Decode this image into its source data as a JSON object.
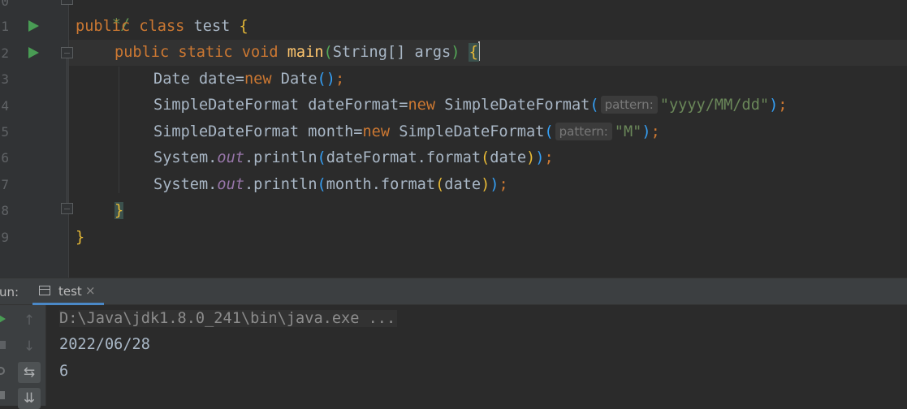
{
  "editor": {
    "line_numbers": [
      "0",
      "1",
      "2",
      "3",
      "4",
      "5",
      "6",
      "7",
      "8",
      "9"
    ],
    "comment_fragment": "*/",
    "lines": {
      "l1": {
        "kw1": "public",
        "kw2": "class",
        "name": "test",
        "brace": "{"
      },
      "l2": {
        "kw1": "public",
        "kw2": "static",
        "kw3": "void",
        "fn": "main",
        "paren_open": "(",
        "params": "String[] args",
        "paren_close": ")",
        "brace": "{"
      },
      "l3": {
        "a": "Date date=",
        "kw": "new",
        "b": "Date",
        "p_open": "(",
        "p_close": ")",
        "end": ";"
      },
      "l4": {
        "a": "SimpleDateFormat dateFormat=",
        "kw": "new",
        "b": "SimpleDateFormat",
        "p_open": "(",
        "hint": "pattern:",
        "str": "\"yyyy/MM/dd\"",
        "p_close": ")",
        "end": ";"
      },
      "l5": {
        "a": "SimpleDateFormat month=",
        "kw": "new",
        "b": "SimpleDateFormat",
        "p_open": "(",
        "hint": "pattern:",
        "str": "\"M\"",
        "p_close": ")",
        "end": ";"
      },
      "l6": {
        "a": "System.",
        "field": "out",
        "b": ".println",
        "p1_open": "(",
        "c": "dateFormat.format",
        "p2_open": "(",
        "d": "date",
        "p2_close": ")",
        "p1_close": ")",
        "end": ";"
      },
      "l7": {
        "a": "System.",
        "field": "out",
        "b": ".println",
        "p1_open": "(",
        "c": "month.format",
        "p2_open": "(",
        "d": "date",
        "p2_close": ")",
        "p1_close": ")",
        "end": ";"
      },
      "l8": {
        "brace": "}"
      },
      "l9": {
        "brace": "}"
      }
    }
  },
  "run_panel": {
    "label": "un:",
    "tab_label": "test",
    "tab_close": "×",
    "output": {
      "command": "D:\\Java\\jdk1.8.0_241\\bin\\java.exe ...",
      "line1": "2022/06/28",
      "line2": "6"
    },
    "toolbar_icons": [
      "up-arrow-icon",
      "down-arrow-icon",
      "soft-wrap-icon",
      "scroll-to-end-icon"
    ]
  },
  "colors": {
    "background": "#2b2b2b",
    "keyword": "#cc7832",
    "function": "#ffc66d",
    "string": "#6a8759",
    "static_field": "#9876aa",
    "run_arrow": "#499c54",
    "tab_underline": "#4a88c7"
  }
}
